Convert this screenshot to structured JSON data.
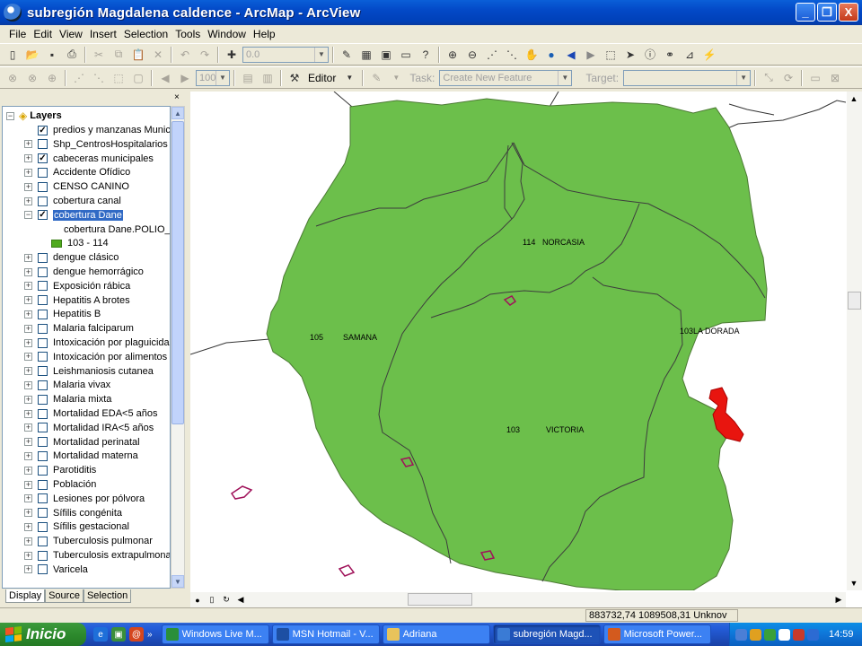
{
  "window": {
    "title": "subregión Magdalena caldence - ArcMap - ArcView",
    "buttons": [
      "_",
      "❐",
      "X"
    ]
  },
  "menu": [
    "File",
    "Edit",
    "View",
    "Insert",
    "Selection",
    "Tools",
    "Window",
    "Help"
  ],
  "toolbar": {
    "scale_value": "0.0",
    "zoom_value": "100",
    "editor_label": "Editor",
    "task_label": "Task:",
    "task_value": "Create New Feature",
    "target_label": "Target:"
  },
  "toc": {
    "root_label": "Layers",
    "layers": [
      {
        "name": "predios y manzanas Municip",
        "checked": true,
        "expanded": false,
        "plus": false
      },
      {
        "name": "Shp_CentrosHospitalarios",
        "checked": false,
        "plus": true
      },
      {
        "name": "cabeceras municipales",
        "checked": true,
        "plus": true
      },
      {
        "name": "Accidente Ofídico",
        "checked": false,
        "plus": true
      },
      {
        "name": "CENSO CANINO",
        "checked": false,
        "plus": true
      },
      {
        "name": "cobertura canal",
        "checked": false,
        "plus": true
      },
      {
        "name": "cobertura Dane",
        "checked": true,
        "expanded": true,
        "selected": true
      }
    ],
    "legend_field": "cobertura Dane.POLIO_C",
    "legend_class": "103 - 114",
    "legend_color": "#4faa1e",
    "more_layers": [
      "dengue clásico",
      "dengue hemorrágico",
      "Exposición rábica",
      "Hepatitis A brotes",
      "Hepatitis B",
      "Malaria falciparum",
      "Intoxicación por plaguicidas",
      "Intoxicación por alimentos",
      "Leishmaniosis cutanea",
      "Malaria vivax",
      "Malaria mixta",
      "Mortalidad EDA<5 años",
      "Mortalidad IRA<5 años",
      "Mortalidad perinatal",
      "Mortalidad materna",
      "Parotiditis",
      "Población",
      "Lesiones por pólvora",
      "Sífilis congénita",
      "Sífilis gestacional",
      "Tuberculosis pulmonar",
      "Tuberculosis extrapulmonar",
      "Varicela"
    ],
    "tabs": [
      "Display",
      "Source",
      "Selection"
    ]
  },
  "map": {
    "fill_color": "#6cbf4b",
    "labels": [
      {
        "code": "114",
        "name": "NORCASIA"
      },
      {
        "code": "105",
        "name": "SAMANA"
      },
      {
        "code": "103",
        "name": "LA DORADA",
        "combined": "103LA DORADA"
      },
      {
        "code": "103",
        "name": "VICTORIA"
      }
    ]
  },
  "status": {
    "coords": "883732,74  1089508,31 Unknov"
  },
  "taskbar": {
    "start_label": "Inicio",
    "tasks": [
      {
        "label": "Windows Live M...",
        "color": "#2a8f3a",
        "active": false
      },
      {
        "label": "MSN Hotmail - V...",
        "color": "#1d4fa3",
        "active": false
      },
      {
        "label": "Adriana",
        "color": "#e8c35b",
        "active": false
      },
      {
        "label": "subregión Magd...",
        "color": "#3a7bd5",
        "active": true
      },
      {
        "label": "Microsoft Power...",
        "color": "#d35a1e",
        "active": false
      }
    ],
    "clock": "14:59"
  }
}
